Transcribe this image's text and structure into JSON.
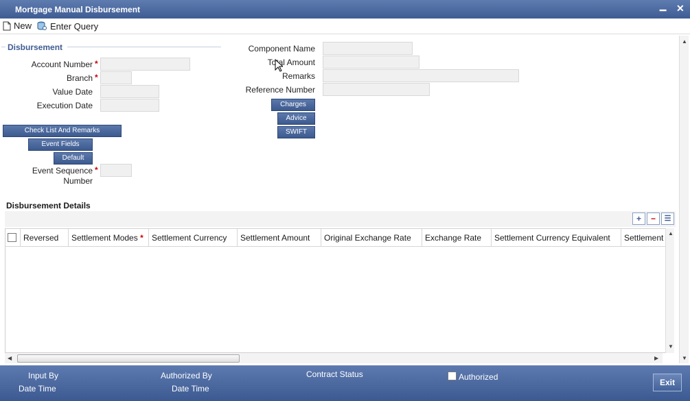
{
  "window": {
    "title": "Mortgage Manual Disbursement",
    "minimize": "▁",
    "close": "✕"
  },
  "toolbar": {
    "new_label": "New",
    "enter_query_label": "Enter Query"
  },
  "disbursement": {
    "legend": "Disbursement",
    "account_number_label": "Account Number",
    "branch_label": "Branch",
    "value_date_label": "Value Date",
    "execution_date_label": "Execution Date",
    "component_name_label": "Component Name",
    "total_amount_label": "Total Amount",
    "remarks_label": "Remarks",
    "reference_number_label": "Reference Number",
    "event_sequence_label_1": "Event Sequence",
    "event_sequence_label_2": "Number",
    "required_mark": "*"
  },
  "buttons": {
    "check_list": "Check List And Remarks",
    "event_fields": "Event Fields",
    "default": "Default",
    "charges": "Charges",
    "advice": "Advice",
    "swift": "SWIFT"
  },
  "details": {
    "title": "Disbursement Details",
    "add_icon": "+",
    "remove_icon": "−",
    "list_icon": "☰",
    "columns": [
      "Reversed",
      "Settlement Modes",
      "Settlement Currency",
      "Settlement Amount",
      "Original Exchange Rate",
      "Exchange Rate",
      "Settlement Currency Equivalent",
      "Settlement"
    ],
    "required_mark": "*"
  },
  "footer": {
    "input_by": "Input By",
    "date_time_1": "Date Time",
    "authorized_by": "Authorized By",
    "date_time_2": "Date Time",
    "contract_status": "Contract Status",
    "authorized": "Authorized",
    "exit": "Exit"
  },
  "colors": {
    "accent": "#3e5c93",
    "required": "#cc0000"
  }
}
